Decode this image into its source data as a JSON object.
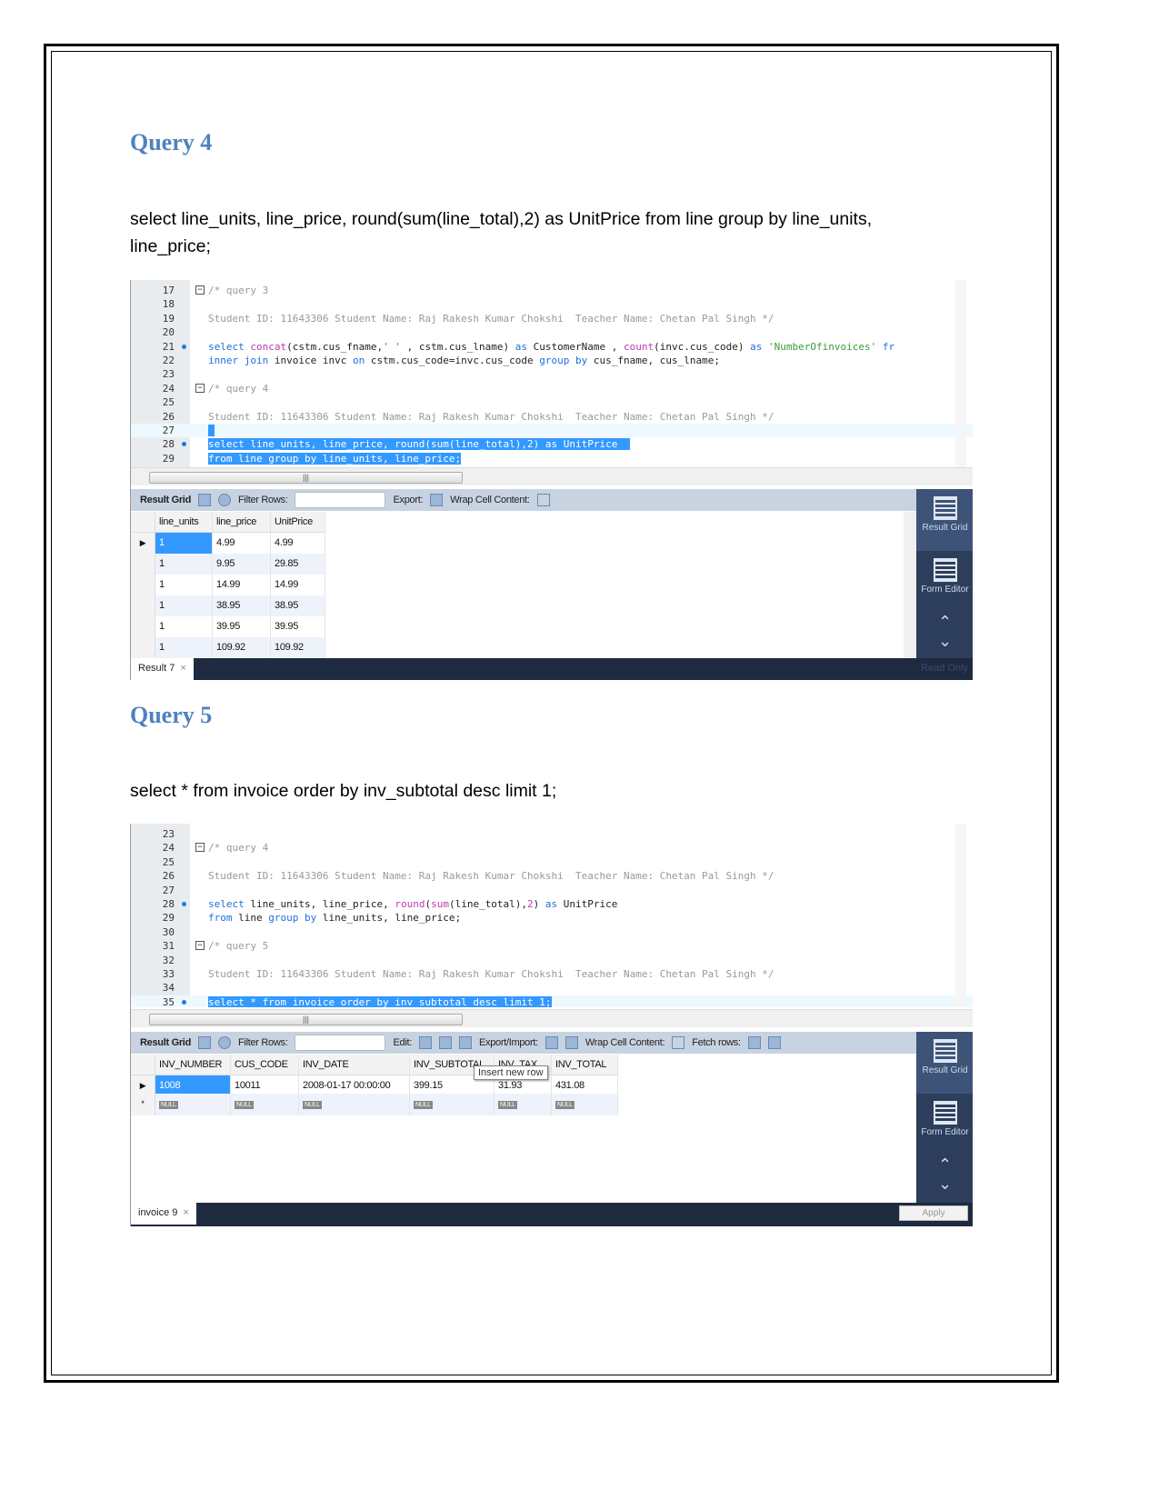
{
  "query4": {
    "heading": "Query 4",
    "sql": "select line_units, line_price, round(sum(line_total),2) as UnitPrice from line group by line_units, line_price;"
  },
  "query5": {
    "heading": "Query 5",
    "sql": "select * from invoice order by inv_subtotal desc limit 1;"
  },
  "shot1": {
    "lines": [
      {
        "n": "17",
        "fold": true,
        "tokens": [
          [
            "cm",
            "/* query 3"
          ]
        ]
      },
      {
        "n": "18",
        "tokens": []
      },
      {
        "n": "19",
        "tokens": [
          [
            "cm",
            "Student ID: 11643306 Student Name: Raj Rakesh Kumar Chokshi  Teacher Name: Chetan Pal Singh */"
          ]
        ]
      },
      {
        "n": "20",
        "tokens": []
      },
      {
        "n": "21",
        "dot": true,
        "tokens": [
          [
            "kw",
            "select "
          ],
          [
            "fn",
            "concat"
          ],
          [
            "",
            "(cstm.cus_fname,"
          ],
          [
            "str",
            "' '"
          ],
          [
            "",
            " , cstm.cus_lname) "
          ],
          [
            "kw",
            "as"
          ],
          [
            "",
            " CustomerName , "
          ],
          [
            "fn",
            "count"
          ],
          [
            "",
            "(invc.cus_code) "
          ],
          [
            "kw",
            "as "
          ],
          [
            "str",
            "'NumberOfinvoices'"
          ],
          [
            "",
            " "
          ],
          [
            "kw",
            "fr"
          ]
        ]
      },
      {
        "n": "22",
        "tokens": [
          [
            "kw",
            "inner join"
          ],
          [
            "",
            " invoice invc "
          ],
          [
            "kw",
            "on"
          ],
          [
            "",
            " cstm.cus_code=invc.cus_code "
          ],
          [
            "kw",
            "group by"
          ],
          [
            "",
            " cus_fname, cus_lname;"
          ]
        ]
      },
      {
        "n": "23",
        "tokens": []
      },
      {
        "n": "24",
        "fold": true,
        "tokens": [
          [
            "cm",
            "/* query 4"
          ]
        ]
      },
      {
        "n": "25",
        "tokens": []
      },
      {
        "n": "26",
        "tokens": [
          [
            "cm",
            "Student ID: 11643306 Student Name: Raj Rakesh Kumar Chokshi  Teacher Name: Chetan Pal Singh */"
          ]
        ]
      },
      {
        "n": "27",
        "cur": true,
        "tokens": [
          [
            "sel",
            " "
          ]
        ]
      },
      {
        "n": "28",
        "dot": true,
        "tokens": [
          [
            "sel",
            "select line_units, line_price, round(sum(line_total),2) as UnitPrice  "
          ]
        ]
      },
      {
        "n": "29",
        "tokens": [
          [
            "sel",
            "from line group by line_units, line_price;"
          ]
        ]
      }
    ],
    "toolbar": {
      "result_grid": "Result Grid",
      "filter": "Filter Rows:",
      "export": "Export:",
      "wrap": "Wrap Cell Content:"
    },
    "columns": [
      "line_units",
      "line_price",
      "UnitPrice"
    ],
    "rows": [
      [
        "1",
        "4.99",
        "4.99"
      ],
      [
        "1",
        "9.95",
        "29.85"
      ],
      [
        "1",
        "14.99",
        "14.99"
      ],
      [
        "1",
        "38.95",
        "38.95"
      ],
      [
        "1",
        "39.95",
        "39.95"
      ],
      [
        "1",
        "109.92",
        "109.92"
      ]
    ],
    "side": {
      "result_grid": "Result Grid",
      "form_editor": "Form Editor"
    },
    "tab": "Result 7",
    "status": "Read Only"
  },
  "shot2": {
    "lines": [
      {
        "n": "23",
        "tokens": []
      },
      {
        "n": "24",
        "fold": true,
        "tokens": [
          [
            "cm",
            "/* query 4"
          ]
        ]
      },
      {
        "n": "25",
        "tokens": []
      },
      {
        "n": "26",
        "tokens": [
          [
            "cm",
            "Student ID: 11643306 Student Name: Raj Rakesh Kumar Chokshi  Teacher Name: Chetan Pal Singh */"
          ]
        ]
      },
      {
        "n": "27",
        "tokens": []
      },
      {
        "n": "28",
        "dot": true,
        "tokens": [
          [
            "kw",
            "select"
          ],
          [
            "",
            " line_units, line_price, "
          ],
          [
            "fn",
            "round"
          ],
          [
            "",
            "("
          ],
          [
            "fn",
            "sum"
          ],
          [
            "",
            "(line_total),"
          ],
          [
            "fn",
            "2"
          ],
          [
            ") "
          ],
          [
            "kw",
            "as"
          ],
          [
            "",
            " UnitPrice"
          ]
        ]
      },
      {
        "n": "29",
        "tokens": [
          [
            "kw",
            "from"
          ],
          [
            "",
            " line "
          ],
          [
            "kw",
            "group by"
          ],
          [
            "",
            " line_units, line_price;"
          ]
        ]
      },
      {
        "n": "30",
        "tokens": []
      },
      {
        "n": "31",
        "fold": true,
        "tokens": [
          [
            "cm",
            "/* query 5"
          ]
        ]
      },
      {
        "n": "32",
        "tokens": []
      },
      {
        "n": "33",
        "tokens": [
          [
            "cm",
            "Student ID: 11643306 Student Name: Raj Rakesh Kumar Chokshi  Teacher Name: Chetan Pal Singh */"
          ]
        ]
      },
      {
        "n": "34",
        "tokens": []
      },
      {
        "n": "35",
        "dot": true,
        "cur": true,
        "tokens": [
          [
            "sel",
            "select * from invoice order by inv_subtotal desc limit 1;"
          ]
        ]
      }
    ],
    "toolbar": {
      "result_grid": "Result Grid",
      "filter": "Filter Rows:",
      "edit": "Edit:",
      "export": "Export/Import:",
      "wrap": "Wrap Cell Content:",
      "fetch": "Fetch rows:"
    },
    "columns": [
      "INV_NUMBER",
      "CUS_CODE",
      "INV_DATE",
      "INV_SUBTOTAL",
      "INV_TAX",
      "INV_TOTAL"
    ],
    "rows": [
      [
        "1008",
        "10011",
        "2008-01-17 00:00:00",
        "399.15",
        "31.93",
        "431.08"
      ]
    ],
    "null_label": "NULL",
    "tooltip": "Insert new row",
    "side": {
      "result_grid": "Result Grid",
      "form_editor": "Form Editor"
    },
    "tab": "invoice 9",
    "apply": "Apply"
  }
}
